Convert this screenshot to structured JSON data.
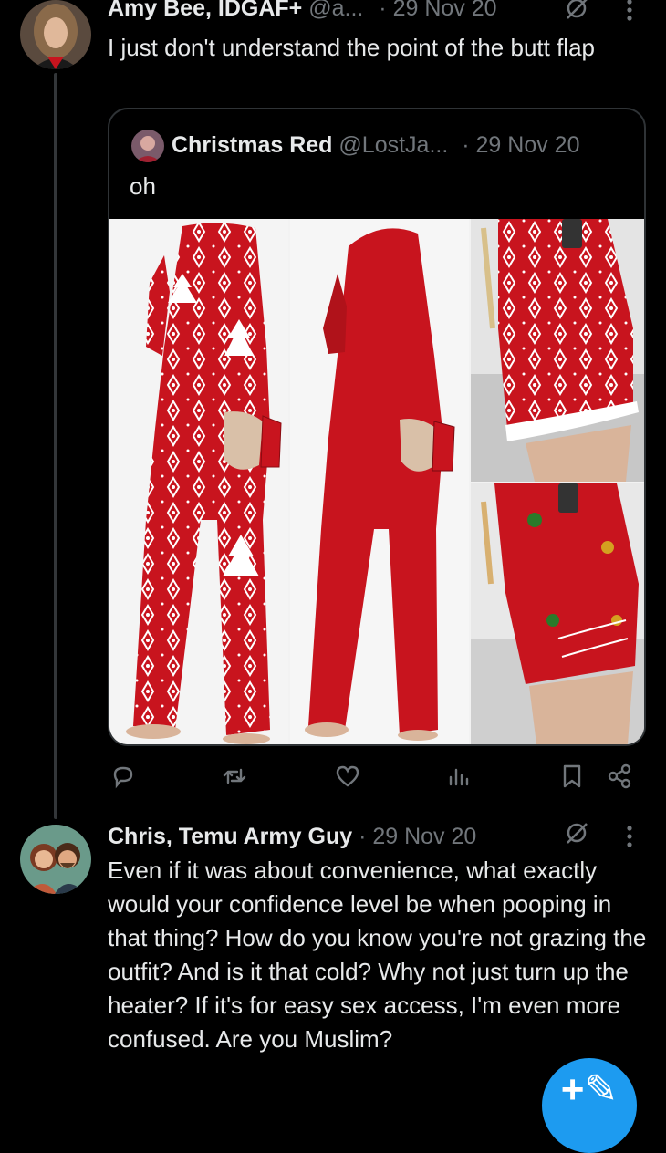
{
  "post": {
    "author_name": "Amy Bee, IDGAF+",
    "author_handle": "@a...",
    "date": "· 29 Nov 20",
    "text": "I just don't understand the point of the butt flap"
  },
  "quoted_post": {
    "author_name": "Christmas Red",
    "author_handle": "@LostJa...",
    "date": "· 29 Nov 20",
    "text": "oh"
  },
  "action_icons": [
    "reply-icon",
    "repost-icon",
    "like-icon",
    "views-icon",
    "bookmark-icon",
    "share-icon"
  ],
  "reply": {
    "author_name": "Chris, Temu Army Guy",
    "date": "· 29 Nov 20",
    "text": "Even if it was about convenience, what exactly would your confidence level be when pooping in that thing? How do you know you're not grazing the outfit? And is it that cold? Why not just turn up the heater? If it's for easy sex access, I'm even more confused. Are you Muslim?"
  },
  "compose_button": {
    "label": "+✎"
  },
  "colors": {
    "background": "#000000",
    "text": "#e7e9ea",
    "muted": "#71767b",
    "border": "#2f3336",
    "accent": "#1d9bf0",
    "garment_red": "#c8141e"
  }
}
